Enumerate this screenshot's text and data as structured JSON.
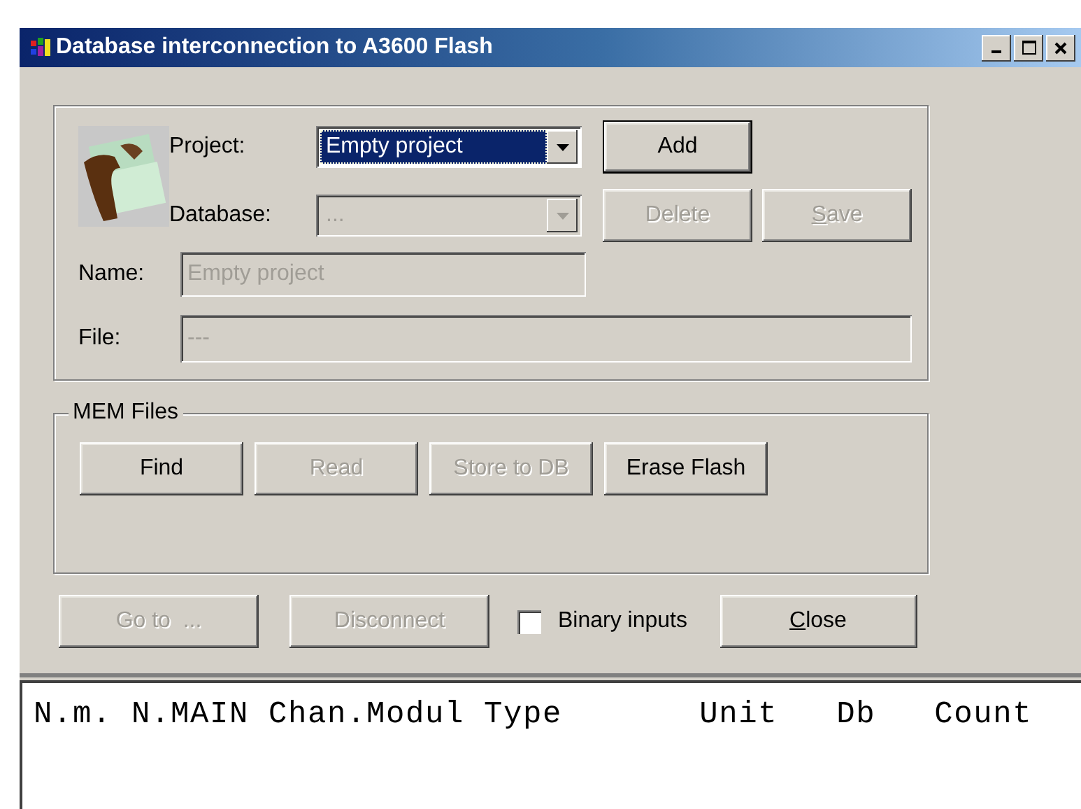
{
  "window": {
    "title": "Database interconnection to A3600 Flash"
  },
  "project_section": {
    "project": {
      "label": "Project:",
      "value": "Empty project",
      "highlighted": true,
      "disabled": false
    },
    "database": {
      "label": "Database:",
      "value": "...",
      "highlighted": false,
      "disabled": true
    },
    "name": {
      "label": "Name:",
      "value": "Empty project",
      "disabled": true
    },
    "file": {
      "label": "File:",
      "value": "---",
      "disabled": true
    },
    "buttons": [
      {
        "label": "Add",
        "disabled": false,
        "default": true
      },
      {
        "label": "Delete",
        "disabled": true,
        "default": false
      },
      {
        "label": "Save",
        "disabled": true,
        "default": false,
        "first_letter_underlined": true
      }
    ]
  },
  "mem_files": {
    "title": "MEM Files",
    "buttons": [
      {
        "label": "Find",
        "disabled": false
      },
      {
        "label": "Read",
        "disabled": true
      },
      {
        "label": "Store to DB",
        "disabled": true
      },
      {
        "label": "Erase Flash",
        "disabled": false
      }
    ]
  },
  "footer": {
    "buttons": [
      {
        "label": "Go to  ...",
        "disabled": true
      },
      {
        "label": "Disconnect",
        "disabled": true
      }
    ],
    "checkbox": {
      "label": "Binary inputs",
      "checked": false
    },
    "close": {
      "label": "Close",
      "disabled": false,
      "first_letter_underlined": true
    }
  },
  "output": {
    "header": "N.m. N.MAIN Chan.Modul Type       Unit   Db   Count"
  }
}
